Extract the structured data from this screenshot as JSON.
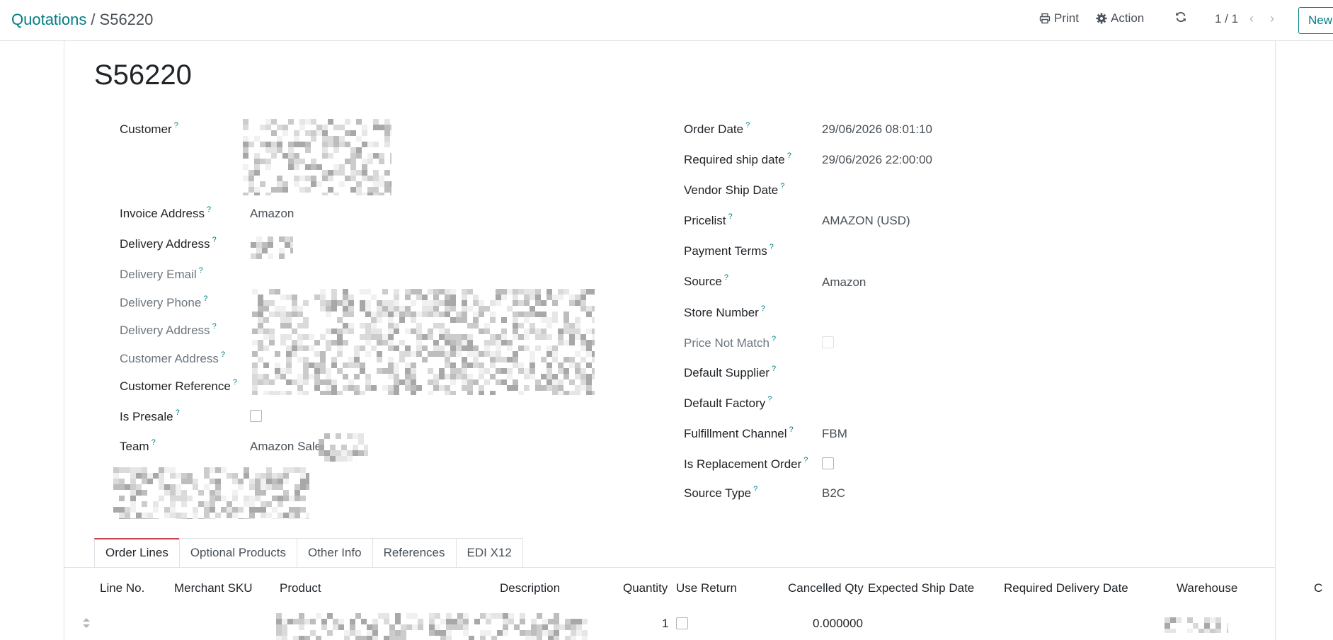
{
  "breadcrumb": {
    "parent": "Quotations",
    "separator": "/",
    "current": "S56220"
  },
  "toolbar": {
    "print_label": "Print",
    "action_label": "Action",
    "pager": "1 / 1",
    "new_label": "New"
  },
  "icons": {
    "print": "printer-icon",
    "action": "gear-icon",
    "refresh": "refresh-icon",
    "prev": "chevron-left-icon",
    "next": "chevron-right-icon",
    "help": "question-mark-icon",
    "drag": "drag-handle-icon"
  },
  "colors": {
    "link": "#017e84",
    "tab_accent": "#c7434f",
    "help": "#017e84",
    "border": "#dee2e6"
  },
  "form": {
    "title": "S56220",
    "help_mark": "?",
    "left": {
      "customer_label": "Customer",
      "invoice_address_label": "Invoice Address",
      "invoice_address_value": "Amazon",
      "delivery_address_label": "Delivery Address",
      "delivery_email_label": "Delivery Email",
      "delivery_phone_label": "Delivery Phone",
      "delivery_address2_label": "Delivery Address",
      "customer_address_label": "Customer Address",
      "customer_reference_label": "Customer Reference",
      "is_presale_label": "Is Presale",
      "is_presale_checked": false,
      "team_label": "Team",
      "team_value": "Amazon Sale"
    },
    "right": {
      "order_date_label": "Order Date",
      "order_date_value": "29/06/2026 08:01:10",
      "required_ship_date_label": "Required ship date",
      "required_ship_date_value": "29/06/2026 22:00:00",
      "vendor_ship_date_label": "Vendor Ship Date",
      "pricelist_label": "Pricelist",
      "pricelist_value": "AMAZON (USD)",
      "payment_terms_label": "Payment Terms",
      "source_label": "Source",
      "source_value": "Amazon",
      "store_number_label": "Store Number",
      "price_not_match_label": "Price Not Match",
      "price_not_match_checked": false,
      "default_supplier_label": "Default Supplier",
      "default_factory_label": "Default Factory",
      "fulfillment_channel_label": "Fulfillment Channel",
      "fulfillment_channel_value": "FBM",
      "is_replacement_order_label": "Is Replacement Order",
      "is_replacement_order_checked": false,
      "source_type_label": "Source Type",
      "source_type_value": "B2C"
    }
  },
  "tabs": [
    "Order Lines",
    "Optional Products",
    "Other Info",
    "References",
    "EDI X12"
  ],
  "active_tab": "Order Lines",
  "order_lines": {
    "columns": [
      "Line No.",
      "Merchant SKU",
      "Product",
      "Description",
      "Quantity",
      "Use Return",
      "Cancelled Qty",
      "Expected Ship Date",
      "Required Delivery Date",
      "Warehouse",
      "C"
    ],
    "rows": [
      {
        "quantity": "1",
        "use_return": false,
        "cancelled_qty": "0.000000"
      }
    ]
  }
}
